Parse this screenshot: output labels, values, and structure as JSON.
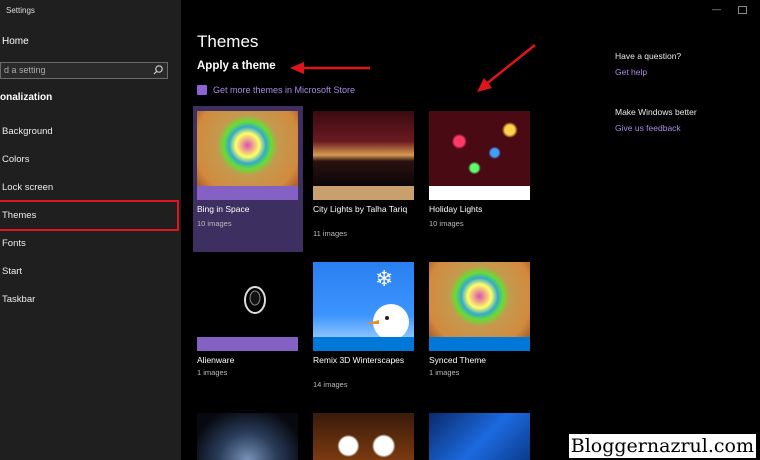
{
  "app_title": "Settings",
  "sidebar": {
    "home_label": "Home",
    "search_placeholder": "d a setting",
    "section_label": "onalization",
    "items": [
      {
        "label": "Background"
      },
      {
        "label": "Colors"
      },
      {
        "label": "Lock screen"
      },
      {
        "label": "Themes"
      },
      {
        "label": "Fonts"
      },
      {
        "label": "Start"
      },
      {
        "label": "Taskbar"
      }
    ]
  },
  "main": {
    "title": "Themes",
    "apply_label": "Apply a theme",
    "store_link": "Get more themes in Microsoft Store",
    "themes": [
      {
        "name": "Bing in Space",
        "count": "10 images",
        "bar_color": "#8661c5"
      },
      {
        "name": "City Lights by Talha Tariq",
        "count": "11 images",
        "bar_color": "#c8a06e"
      },
      {
        "name": "Holiday Lights",
        "count": "10 images",
        "bar_color": "#ffffff"
      },
      {
        "name": "Alienware",
        "count": "1 images",
        "bar_color": "#8661c5"
      },
      {
        "name": "Remix 3D Winterscapes",
        "count": "14 images",
        "bar_color": "#0078d7"
      },
      {
        "name": "Synced Theme",
        "count": "1 images",
        "bar_color": "#0078d7"
      }
    ]
  },
  "right_panel": {
    "question_heading": "Have a question?",
    "help_link": "Get help",
    "better_heading": "Make Windows better",
    "feedback_link": "Give us feedback"
  },
  "watermark": "Bloggernazrul.com",
  "accent_color": "#8661c5",
  "annotation_color": "#e0141b"
}
